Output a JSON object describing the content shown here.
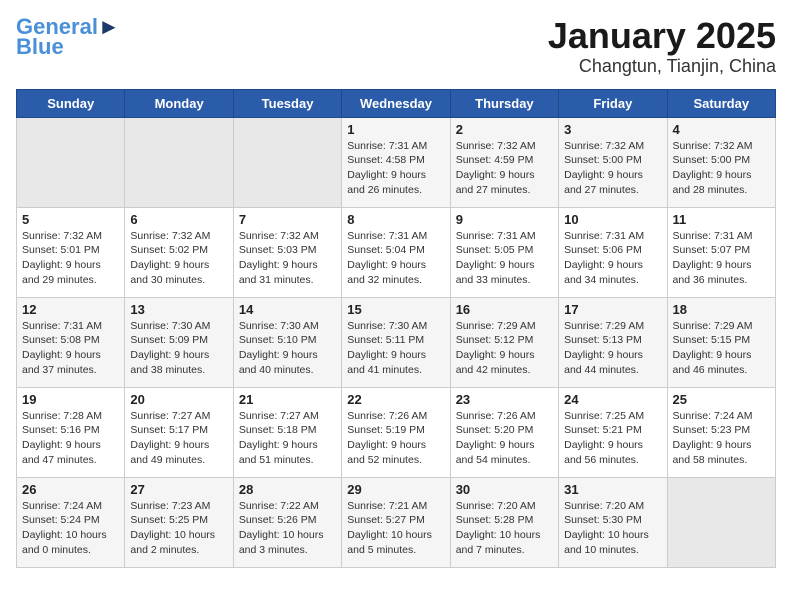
{
  "logo": {
    "part1": "General",
    "part2": "Blue"
  },
  "title": "January 2025",
  "subtitle": "Changtun, Tianjin, China",
  "weekdays": [
    "Sunday",
    "Monday",
    "Tuesday",
    "Wednesday",
    "Thursday",
    "Friday",
    "Saturday"
  ],
  "weeks": [
    [
      {
        "day": "",
        "content": ""
      },
      {
        "day": "",
        "content": ""
      },
      {
        "day": "",
        "content": ""
      },
      {
        "day": "1",
        "content": "Sunrise: 7:31 AM\nSunset: 4:58 PM\nDaylight: 9 hours\nand 26 minutes."
      },
      {
        "day": "2",
        "content": "Sunrise: 7:32 AM\nSunset: 4:59 PM\nDaylight: 9 hours\nand 27 minutes."
      },
      {
        "day": "3",
        "content": "Sunrise: 7:32 AM\nSunset: 5:00 PM\nDaylight: 9 hours\nand 27 minutes."
      },
      {
        "day": "4",
        "content": "Sunrise: 7:32 AM\nSunset: 5:00 PM\nDaylight: 9 hours\nand 28 minutes."
      }
    ],
    [
      {
        "day": "5",
        "content": "Sunrise: 7:32 AM\nSunset: 5:01 PM\nDaylight: 9 hours\nand 29 minutes."
      },
      {
        "day": "6",
        "content": "Sunrise: 7:32 AM\nSunset: 5:02 PM\nDaylight: 9 hours\nand 30 minutes."
      },
      {
        "day": "7",
        "content": "Sunrise: 7:32 AM\nSunset: 5:03 PM\nDaylight: 9 hours\nand 31 minutes."
      },
      {
        "day": "8",
        "content": "Sunrise: 7:31 AM\nSunset: 5:04 PM\nDaylight: 9 hours\nand 32 minutes."
      },
      {
        "day": "9",
        "content": "Sunrise: 7:31 AM\nSunset: 5:05 PM\nDaylight: 9 hours\nand 33 minutes."
      },
      {
        "day": "10",
        "content": "Sunrise: 7:31 AM\nSunset: 5:06 PM\nDaylight: 9 hours\nand 34 minutes."
      },
      {
        "day": "11",
        "content": "Sunrise: 7:31 AM\nSunset: 5:07 PM\nDaylight: 9 hours\nand 36 minutes."
      }
    ],
    [
      {
        "day": "12",
        "content": "Sunrise: 7:31 AM\nSunset: 5:08 PM\nDaylight: 9 hours\nand 37 minutes."
      },
      {
        "day": "13",
        "content": "Sunrise: 7:30 AM\nSunset: 5:09 PM\nDaylight: 9 hours\nand 38 minutes."
      },
      {
        "day": "14",
        "content": "Sunrise: 7:30 AM\nSunset: 5:10 PM\nDaylight: 9 hours\nand 40 minutes."
      },
      {
        "day": "15",
        "content": "Sunrise: 7:30 AM\nSunset: 5:11 PM\nDaylight: 9 hours\nand 41 minutes."
      },
      {
        "day": "16",
        "content": "Sunrise: 7:29 AM\nSunset: 5:12 PM\nDaylight: 9 hours\nand 42 minutes."
      },
      {
        "day": "17",
        "content": "Sunrise: 7:29 AM\nSunset: 5:13 PM\nDaylight: 9 hours\nand 44 minutes."
      },
      {
        "day": "18",
        "content": "Sunrise: 7:29 AM\nSunset: 5:15 PM\nDaylight: 9 hours\nand 46 minutes."
      }
    ],
    [
      {
        "day": "19",
        "content": "Sunrise: 7:28 AM\nSunset: 5:16 PM\nDaylight: 9 hours\nand 47 minutes."
      },
      {
        "day": "20",
        "content": "Sunrise: 7:27 AM\nSunset: 5:17 PM\nDaylight: 9 hours\nand 49 minutes."
      },
      {
        "day": "21",
        "content": "Sunrise: 7:27 AM\nSunset: 5:18 PM\nDaylight: 9 hours\nand 51 minutes."
      },
      {
        "day": "22",
        "content": "Sunrise: 7:26 AM\nSunset: 5:19 PM\nDaylight: 9 hours\nand 52 minutes."
      },
      {
        "day": "23",
        "content": "Sunrise: 7:26 AM\nSunset: 5:20 PM\nDaylight: 9 hours\nand 54 minutes."
      },
      {
        "day": "24",
        "content": "Sunrise: 7:25 AM\nSunset: 5:21 PM\nDaylight: 9 hours\nand 56 minutes."
      },
      {
        "day": "25",
        "content": "Sunrise: 7:24 AM\nSunset: 5:23 PM\nDaylight: 9 hours\nand 58 minutes."
      }
    ],
    [
      {
        "day": "26",
        "content": "Sunrise: 7:24 AM\nSunset: 5:24 PM\nDaylight: 10 hours\nand 0 minutes."
      },
      {
        "day": "27",
        "content": "Sunrise: 7:23 AM\nSunset: 5:25 PM\nDaylight: 10 hours\nand 2 minutes."
      },
      {
        "day": "28",
        "content": "Sunrise: 7:22 AM\nSunset: 5:26 PM\nDaylight: 10 hours\nand 3 minutes."
      },
      {
        "day": "29",
        "content": "Sunrise: 7:21 AM\nSunset: 5:27 PM\nDaylight: 10 hours\nand 5 minutes."
      },
      {
        "day": "30",
        "content": "Sunrise: 7:20 AM\nSunset: 5:28 PM\nDaylight: 10 hours\nand 7 minutes."
      },
      {
        "day": "31",
        "content": "Sunrise: 7:20 AM\nSunset: 5:30 PM\nDaylight: 10 hours\nand 10 minutes."
      },
      {
        "day": "",
        "content": ""
      }
    ]
  ]
}
